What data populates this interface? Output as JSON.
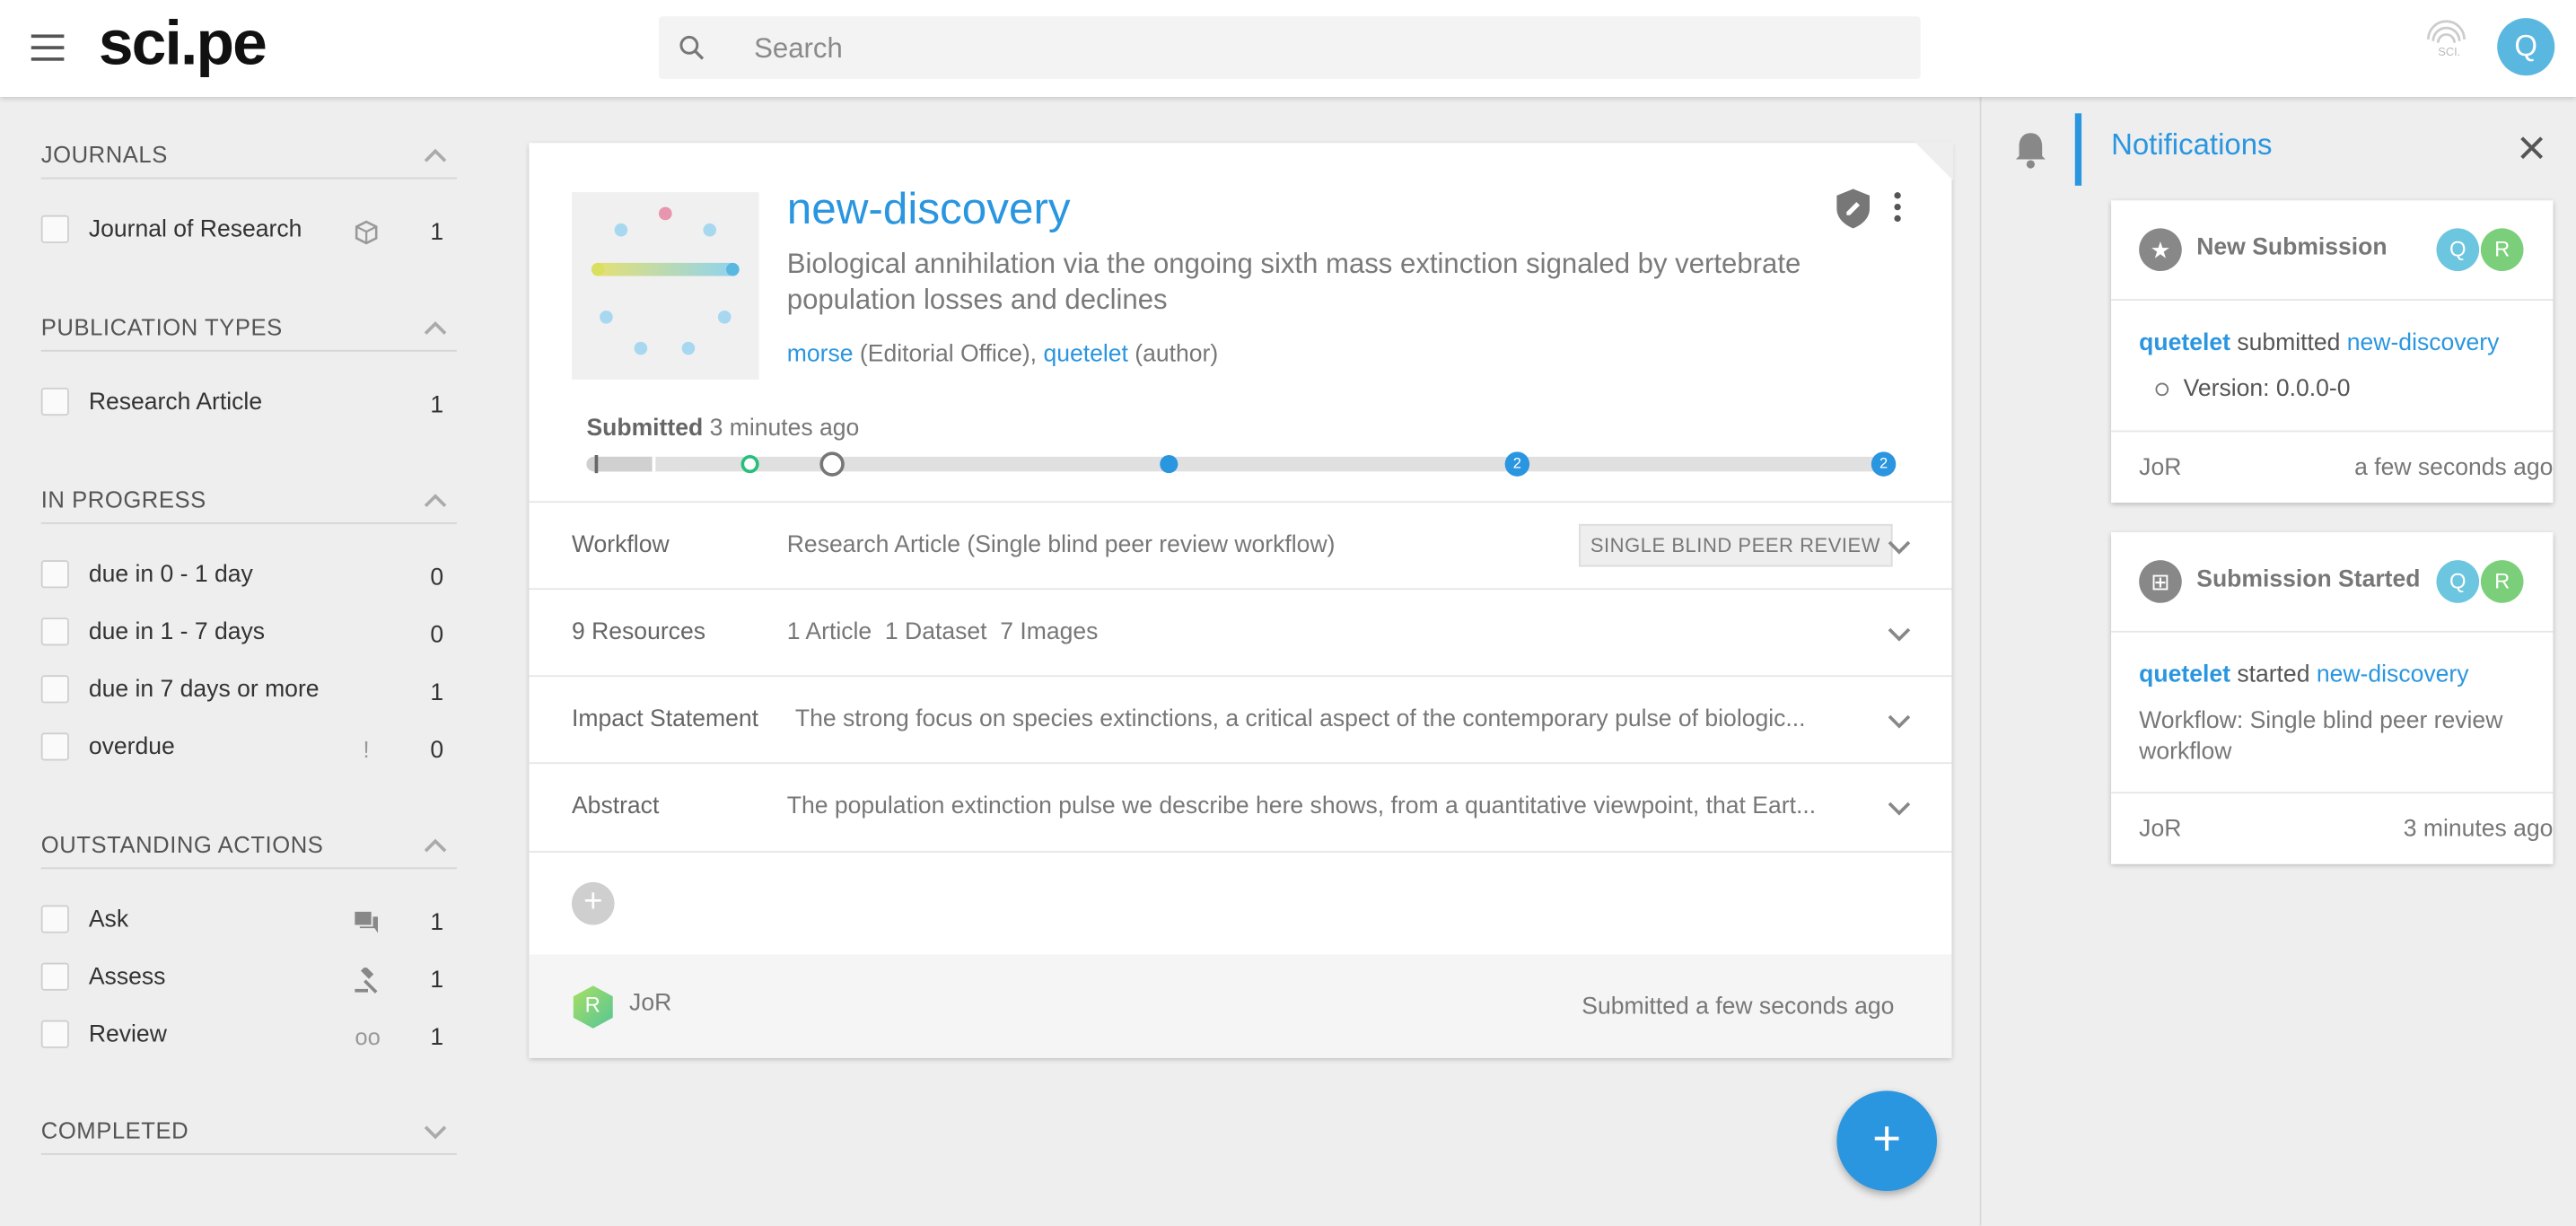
{
  "header": {
    "logo": "sci.pe",
    "search_placeholder": "Search",
    "user_initial": "Q"
  },
  "sidebar": {
    "journals": {
      "title": "JOURNALS",
      "items": [
        {
          "label": "Journal of Research",
          "count": "1"
        }
      ]
    },
    "publication_types": {
      "title": "PUBLICATION TYPES",
      "items": [
        {
          "label": "Research Article",
          "count": "1"
        }
      ]
    },
    "in_progress": {
      "title": "IN PROGRESS",
      "items": [
        {
          "label": "due in 0 - 1 day",
          "count": "0"
        },
        {
          "label": "due in 1 - 7 days",
          "count": "0"
        },
        {
          "label": "due in 7 days or more",
          "count": "1"
        },
        {
          "label": "overdue",
          "count": "0",
          "marker": "!"
        }
      ]
    },
    "outstanding_actions": {
      "title": "OUTSTANDING ACTIONS",
      "items": [
        {
          "label": "Ask",
          "count": "1"
        },
        {
          "label": "Assess",
          "count": "1"
        },
        {
          "label": "Review",
          "count": "1",
          "marker": "oo"
        }
      ]
    },
    "completed": {
      "title": "COMPLETED"
    }
  },
  "card": {
    "title": "new-discovery",
    "subtitle": "Biological annihilation via the ongoing sixth mass extinction signaled by vertebrate population losses and declines",
    "contributor1": "morse",
    "role1": "(Editorial Office),",
    "contributor2": "quetelet",
    "role2": "(author)",
    "submitted_label": "Submitted",
    "submitted_time": "3 minutes ago",
    "timeline_markers": [
      "2",
      "2"
    ],
    "rows": [
      {
        "key": "Workflow",
        "value": "Research Article (Single blind peer review workflow)",
        "badge": "SINGLE BLIND PEER REVIEW"
      },
      {
        "key": "9 Resources",
        "value": "1 Article  1 Dataset  7 Images"
      },
      {
        "key": "Impact Statement",
        "value": "The strong focus on species extinctions, a critical aspect of the contemporary pulse of biologic..."
      },
      {
        "key": "Abstract",
        "value": "The population extinction pulse we describe here shows, from a quantitative viewpoint, that Eart..."
      }
    ],
    "footer": {
      "journal_initial": "R",
      "journal": "JoR",
      "status": "Submitted a few seconds ago"
    }
  },
  "notifications": {
    "title": "Notifications",
    "items": [
      {
        "title": "New Submission",
        "actor": "quetelet",
        "verb": "submitted",
        "object": "new-discovery",
        "detail": "Version: 0.0.0-0",
        "journal": "JoR",
        "time": "a few seconds ago"
      },
      {
        "title": "Submission Started",
        "actor": "quetelet",
        "verb": "started",
        "object": "new-discovery",
        "detail": "Workflow: Single blind peer review workflow",
        "journal": "JoR",
        "time": "3 minutes ago"
      }
    ],
    "avatars": [
      "Q",
      "R"
    ]
  },
  "colors": {
    "accent": "#2a96e0",
    "green": "#27c07a",
    "gray": "#e0e0e0"
  }
}
